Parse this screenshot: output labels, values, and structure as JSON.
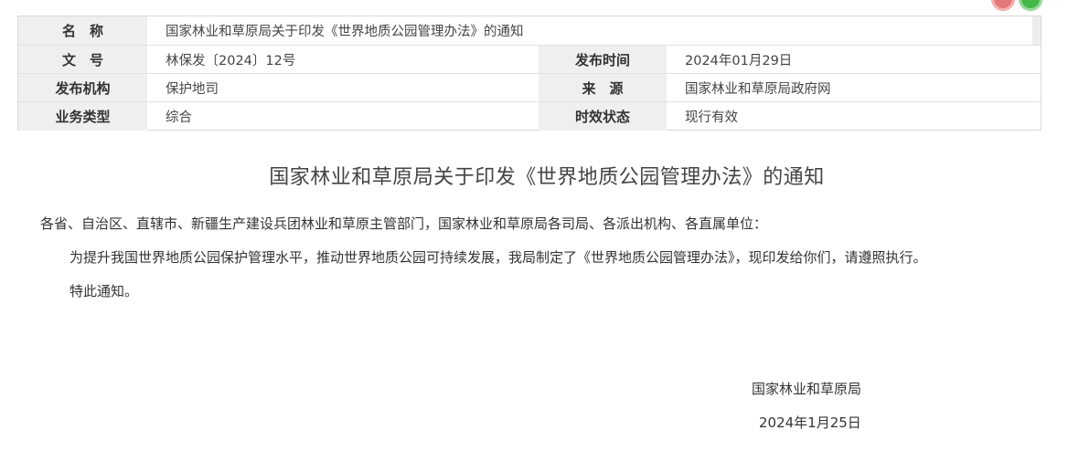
{
  "meta": {
    "name_label": "名　称",
    "name_value": "国家林业和草原局关于印发《世界地质公园管理办法》的通知",
    "docno_label": "文　号",
    "docno_value": "林保发〔2024〕12号",
    "pubtime_label": "发布时间",
    "pubtime_value": "2024年01月29日",
    "issuer_label": "发布机构",
    "issuer_value": "保护地司",
    "source_label": "来　源",
    "source_value": "国家林业和草原局政府网",
    "type_label": "业务类型",
    "type_value": "综合",
    "status_label": "时效状态",
    "status_value": "现行有效"
  },
  "document": {
    "title": "国家林业和草原局关于印发《世界地质公园管理办法》的通知",
    "addressee": "各省、自治区、直辖市、新疆生产建设兵团林业和草原主管部门，国家林业和草原局各司局、各派出机构、各直属单位：",
    "paragraph1": "为提升我国世界地质公园保护管理水平，推动世界地质公园可持续发展，我局制定了《世界地质公园管理办法》，现印发给你们，请遵照执行。",
    "paragraph2": "特此通知。",
    "signature_org": "国家林业和草原局",
    "signature_date": "2024年1月25日"
  },
  "icons": {
    "red_button": "close-icon",
    "green_button": "maximize-icon",
    "red_color": "#e57878",
    "green_color": "#45b84a"
  }
}
